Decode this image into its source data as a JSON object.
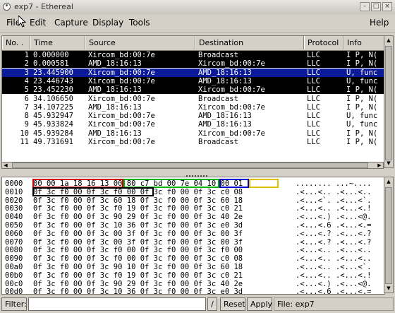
{
  "window": {
    "title": "exp7 - Ethereal"
  },
  "menu": [
    {
      "label": "File"
    },
    {
      "label": "Edit"
    },
    {
      "label": "Capture"
    },
    {
      "label": "Display"
    },
    {
      "label": "Tools"
    },
    {
      "label": "Help"
    }
  ],
  "packet_list": {
    "columns": [
      "No. .",
      "Time",
      "Source",
      "Destination",
      "Protocol",
      "Info"
    ],
    "rows": [
      {
        "no": "1",
        "time": "0.000000",
        "source": "Xircom_bd:00:7e",
        "destination": "Broadcast",
        "protocol": "LLC",
        "info": "I P, N(",
        "style": "black"
      },
      {
        "no": "2",
        "time": "0.000581",
        "source": "AMD_18:16:13",
        "destination": "Xircom_bd:00:7e",
        "protocol": "LLC",
        "info": "I P, N(",
        "style": "black"
      },
      {
        "no": "3",
        "time": "23.445900",
        "source": "Xircom_bd:00:7e",
        "destination": "AMD_18:16:13",
        "protocol": "LLC",
        "info": "U, func",
        "style": "blue"
      },
      {
        "no": "4",
        "time": "23.446743",
        "source": "Xircom_bd:00:7e",
        "destination": "AMD_18:16:13",
        "protocol": "LLC",
        "info": "U, func",
        "style": "black"
      },
      {
        "no": "5",
        "time": "23.452230",
        "source": "AMD_18:16:13",
        "destination": "Xircom_bd:00:7e",
        "protocol": "LLC",
        "info": "I P, N(",
        "style": "black"
      },
      {
        "no": "6",
        "time": "34.106650",
        "source": "Xircom_bd:00:7e",
        "destination": "Broadcast",
        "protocol": "LLC",
        "info": "I P, N(",
        "style": "white"
      },
      {
        "no": "7",
        "time": "34.107225",
        "source": "AMD_18:16:13",
        "destination": "Xircom_bd:00:7e",
        "protocol": "LLC",
        "info": "I P, N(",
        "style": "white"
      },
      {
        "no": "8",
        "time": "45.932947",
        "source": "Xircom_bd:00:7e",
        "destination": "AMD_18:16:13",
        "protocol": "LLC",
        "info": "U, func",
        "style": "white"
      },
      {
        "no": "9",
        "time": "45.933824",
        "source": "Xircom_bd:00:7e",
        "destination": "AMD_18:16:13",
        "protocol": "LLC",
        "info": "U, func",
        "style": "white"
      },
      {
        "no": "10",
        "time": "45.939284",
        "source": "AMD_18:16:13",
        "destination": "Xircom_bd:00:7e",
        "protocol": "LLC",
        "info": "I P, N(",
        "style": "white"
      },
      {
        "no": "11",
        "time": "49.731691",
        "source": "Xircom_bd:00:7e",
        "destination": "Broadcast",
        "protocol": "LLC",
        "info": "I P, N(",
        "style": "white"
      }
    ]
  },
  "hex_dump": {
    "rows": [
      {
        "offset": "0000",
        "hex": "00 00 1a 18 16 13 00 80  c7 bd 00 7e 04 10 00 01",
        "ascii": "........ ...~...."
      },
      {
        "offset": "0010",
        "hex": "0f 3c f0 00 0f 3c f0 00  0f 3c f0 00 0f 3c c0 08",
        "ascii": ".<...<.. .<...<.."
      },
      {
        "offset": "0020",
        "hex": "0f 3c f0 00 0f 3c 60 18  0f 3c f0 00 0f 3c 60 18",
        "ascii": ".<...<`. .<...<`."
      },
      {
        "offset": "0030",
        "hex": "0f 3c f0 00 0f 3c f0 19  0f 3c f0 00 0f 3c c0 21",
        "ascii": ".<...<.. .<...<.!"
      },
      {
        "offset": "0040",
        "hex": "0f 3c f0 00 0f 3c 90 29  0f 3c f0 00 0f 3c 40 2e",
        "ascii": ".<...<.) .<...<@."
      },
      {
        "offset": "0050",
        "hex": "0f 3c f0 00 0f 3c 10 36  0f 3c f0 00 0f 3c e0 3d",
        "ascii": ".<...<.6 .<...<.="
      },
      {
        "offset": "0060",
        "hex": "0f 3c f0 00 0f 3c 00 3f  0f 3c f0 00 0f 3c 00 3f",
        "ascii": ".<...<.? .<...<.?"
      },
      {
        "offset": "0070",
        "hex": "0f 3c f0 00 0f 3c 00 3f  0f 3c f0 00 0f 3c 00 3f",
        "ascii": ".<...<.? .<...<.?"
      },
      {
        "offset": "0080",
        "hex": "0f 3c f0 00 0f 3c f0 00  0f 3c f0 00 0f 3c f0 00",
        "ascii": ".<...<.. .<...<.."
      },
      {
        "offset": "0090",
        "hex": "0f 3c f0 00 0f 3c f0 00  0f 3c f0 00 0f 3c c0 08",
        "ascii": ".<...<.. .<...<.."
      },
      {
        "offset": "00a0",
        "hex": "0f 3c f0 00 0f 3c 90 10  0f 3c f0 00 0f 3c 60 18",
        "ascii": ".<...<.. .<...<`."
      },
      {
        "offset": "00b0",
        "hex": "0f 3c f0 00 0f 3c f0 19  0f 3c f0 00 0f 3c c0 21",
        "ascii": ".<...<.. .<...<.!"
      },
      {
        "offset": "00c0",
        "hex": "0f 3c f0 00 0f 3c 90 29  0f 3c f0 00 0f 3c 40 2e",
        "ascii": ".<...<.) .<...<@."
      },
      {
        "offset": "00d0",
        "hex": "0f 3c f0 00 0f 3c 10 36  0f 3c f0 00 0f 3c e0 3d",
        "ascii": ".<...<.6 .<...<.="
      }
    ],
    "highlight_colors": [
      "#d00000",
      "#00b000",
      "#0000d0",
      "#e0c000",
      "#000000"
    ]
  },
  "filter": {
    "label": "Filter:",
    "value": "",
    "slash": "/",
    "reset": "Reset",
    "apply": "Apply",
    "status": "File: exp7"
  }
}
